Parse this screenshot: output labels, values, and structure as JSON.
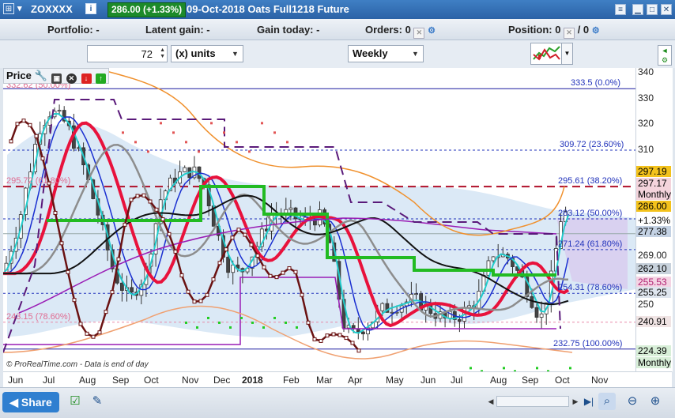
{
  "titlebar": {
    "symbol": "ZOXXXX",
    "price_change": "286.00 (+1.33%)",
    "description": "09-Oct-2018 Oats Full1218 Future",
    "info_icon": "info-icon"
  },
  "infobar": {
    "portfolio": "Portfolio: -",
    "latent_gain": "Latent gain: -",
    "gain_today": "Gain today: -",
    "orders": "Orders: 0",
    "position": "Position: 0",
    "position_suffix": "/ 0"
  },
  "toolbar": {
    "quantity": "72",
    "units": "(x) units",
    "timeframe": "Weekly"
  },
  "price_panel": {
    "label": "Price",
    "footnote": "© ProRealTime.com - Data is end of day"
  },
  "fib_labels": [
    {
      "text": "333.5 (0.0%)",
      "color": "#2233bb"
    },
    {
      "text": "309.72 (23.60%)",
      "color": "#2233bb"
    },
    {
      "text": "295.61 (38.20%)",
      "color": "#2233bb"
    },
    {
      "text": "283.12 (50.00%)",
      "color": "#2233bb"
    },
    {
      "text": "271.24 (61.80%)",
      "color": "#2233bb"
    },
    {
      "text": "254.31 (78.60%)",
      "color": "#2233bb"
    },
    {
      "text": "232.75 (100.00%)",
      "color": "#2233bb"
    }
  ],
  "fib_labels_left": [
    {
      "text": "332.62 (50.00%)",
      "color": "#e06a90"
    },
    {
      "text": "295.72 (61.80%)",
      "color": "#e06a90"
    },
    {
      "text": "243.15 (78.60%)",
      "color": "#e06a90"
    }
  ],
  "y_axis": {
    "ticks": [
      "340",
      "330",
      "320",
      "310",
      "269.00",
      "250"
    ],
    "tags": [
      {
        "text": "297.19",
        "bg": "#f3c21c",
        "color": "#000"
      },
      {
        "text": "297.17",
        "bg": "#f4d4dc",
        "color": "#000"
      },
      {
        "text": "Monthly",
        "bg": "#f4d4dc",
        "color": "#000"
      },
      {
        "text": "286.00",
        "bg": "#f3c21c",
        "color": "#000"
      },
      {
        "text": "+1.33%",
        "bg": "#ffffff",
        "color": "#000"
      },
      {
        "text": "277.38",
        "bg": "#c4d2e4",
        "color": "#000"
      },
      {
        "text": "262.10",
        "bg": "#c8d2dc",
        "color": "#000"
      },
      {
        "text": "255.53",
        "bg": "#f4d4e4",
        "color": "#b02070"
      },
      {
        "text": "255.25",
        "bg": "#dfe6ef",
        "color": "#000"
      },
      {
        "text": "240.91",
        "bg": "#f0e4e4",
        "color": "#000"
      },
      {
        "text": "224.39",
        "bg": "#d8efd8",
        "color": "#000"
      },
      {
        "text": "Monthly",
        "bg": "#d8efd8",
        "color": "#000"
      }
    ]
  },
  "x_axis": {
    "months": [
      "Jun",
      "Jul",
      "Aug",
      "Sep",
      "Oct",
      "Nov",
      "Dec",
      "2018",
      "Feb",
      "Mar",
      "Apr",
      "May",
      "Jun",
      "Jul",
      "Aug",
      "Sep",
      "Oct",
      "Nov"
    ]
  },
  "colors": {
    "candle_up": "#ffffff",
    "candle_down": "#444444",
    "ema_green": "#22bb22",
    "ema_red": "#e8123c",
    "ema_blue": "#1a2fd0",
    "ema_cyan": "#22cccc",
    "ema_gray": "#8d8d8d",
    "ema_black": "#111111",
    "purple": "#9a1db5",
    "orange": "#f0902c",
    "maroon": "#6a1212",
    "fib_blue": "#2233bb",
    "fib_red": "#b0102a"
  },
  "bottom_toolbar": {
    "share": "Share"
  }
}
